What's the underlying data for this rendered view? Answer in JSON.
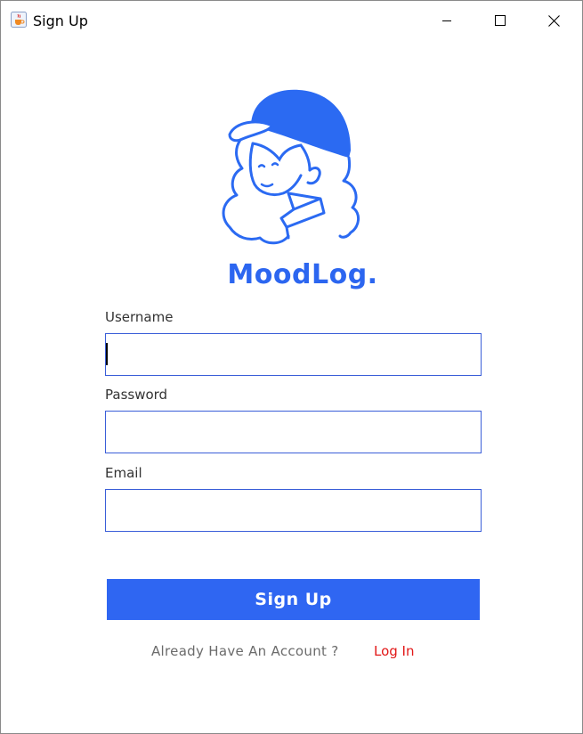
{
  "window": {
    "title": "Sign Up",
    "app_icon": "java-cup-icon",
    "controls": {
      "minimize": "minimize-icon",
      "maximize": "maximize-icon",
      "close": "close-icon"
    }
  },
  "brand": {
    "name": "MoodLog.",
    "logo": "girl-with-cap-illustration",
    "color": "#2c66f0"
  },
  "form": {
    "username": {
      "label": "Username",
      "value": ""
    },
    "password": {
      "label": "Password",
      "value": ""
    },
    "email": {
      "label": "Email",
      "value": ""
    },
    "submit_label": "Sign Up",
    "submit_color": "#2f66f2"
  },
  "footer": {
    "prompt": "Already Have An Account ?",
    "login_label": "Log In",
    "login_color": "#e21818"
  }
}
